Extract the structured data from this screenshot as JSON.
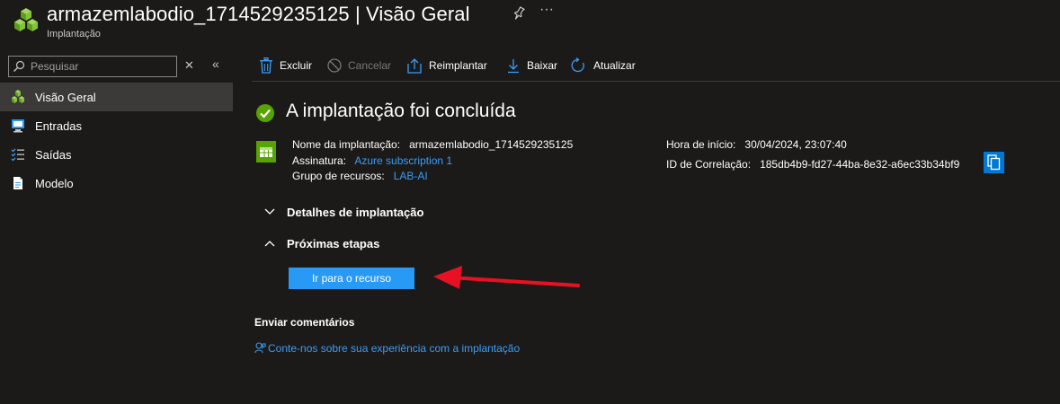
{
  "header": {
    "title": "armazemlabodio_1714529235125 | Visão Geral",
    "subtitle": "Implantação",
    "more": "···"
  },
  "sidebar": {
    "search_placeholder": "Pesquisar",
    "items": [
      {
        "label": "Visão Geral",
        "icon": "cubes-icon",
        "active": true
      },
      {
        "label": "Entradas",
        "icon": "inputs-icon"
      },
      {
        "label": "Saídas",
        "icon": "outputs-icon"
      },
      {
        "label": "Modelo",
        "icon": "template-icon"
      }
    ]
  },
  "toolbar": {
    "delete": "Excluir",
    "cancel": "Cancelar",
    "redeploy": "Reimplantar",
    "download": "Baixar",
    "refresh": "Atualizar"
  },
  "main": {
    "status_title": "A implantação foi concluída",
    "deployment_name_label": "Nome da implantação:",
    "deployment_name": "armazemlabodio_1714529235125",
    "subscription_label": "Assinatura:",
    "subscription": "Azure subscription 1",
    "resource_group_label": "Grupo de recursos:",
    "resource_group": "LAB-AI",
    "start_time_label": "Hora de início:",
    "start_time": "30/04/2024, 23:07:40",
    "correlation_label": "ID de Correlação:",
    "correlation_id": "185db4b9-fd27-44ba-8e32-a6ec33b34bf9",
    "details_section": "Detalhes de implantação",
    "next_steps_section": "Próximas etapas",
    "go_to_resource": "Ir para o recurso",
    "feedback_title": "Enviar comentários",
    "feedback_link": "Conte-nos sobre sua experiência com a implantação"
  },
  "colors": {
    "background": "#1b1a19",
    "active_nav": "#3b3a39",
    "link": "#3b9cf6",
    "primary_button": "#2899f5",
    "success": "#57a300",
    "annotation_arrow": "#e81123"
  }
}
